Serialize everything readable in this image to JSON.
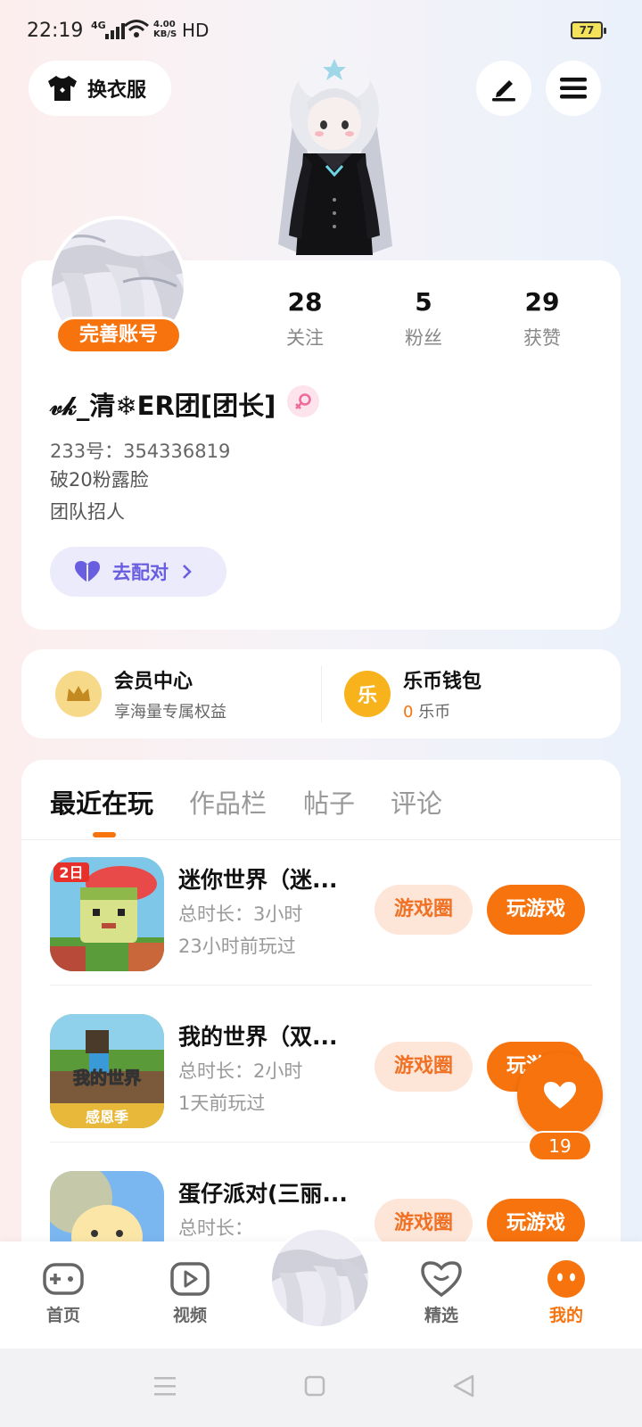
{
  "status_bar": {
    "time": "22:19",
    "network": "4G",
    "speed_top": "4.00",
    "speed_bottom": "KB/S",
    "hd": "HD",
    "battery": "77"
  },
  "top": {
    "outfit_label": "换衣服"
  },
  "profile": {
    "complete_account": "完善账号",
    "stats": [
      {
        "num": "28",
        "label": "关注"
      },
      {
        "num": "5",
        "label": "粉丝"
      },
      {
        "num": "29",
        "label": "获赞"
      }
    ],
    "username": "𝓋𝓀_清❄ER团[团长]",
    "uid": "233号：354336819",
    "bio_lines": [
      "破20粉露脸",
      "团队招人"
    ],
    "match_label": "去配对"
  },
  "member": {
    "vip_title": "会员中心",
    "vip_sub": "享海量专属权益",
    "wallet_title": "乐币钱包",
    "wallet_amount": "0",
    "wallet_unit": "乐币",
    "wallet_icon_char": "乐"
  },
  "tabs": [
    "最近在玩",
    "作品栏",
    "帖子",
    "评论"
  ],
  "games": [
    {
      "name": "迷你世界（迷...",
      "duration": "总时长：3小时",
      "last": "23小时前玩过",
      "circle": "游戏圈",
      "play": "玩游戏"
    },
    {
      "name": "我的世界（双...",
      "duration": "总时长：2小时",
      "last": "1天前玩过",
      "circle": "游戏圈",
      "play": "玩游戏",
      "icon_text_top": "我的世界",
      "icon_text_bottom": "感恩季"
    },
    {
      "name": "蛋仔派对(三丽...",
      "duration": "总时长：",
      "last": "",
      "circle": "游戏圈",
      "play": "玩游戏"
    }
  ],
  "float_like_count": "19",
  "nav": [
    {
      "label": "首页"
    },
    {
      "label": "视频"
    },
    {
      "label": "精选"
    },
    {
      "label": "我的"
    }
  ],
  "colors": {
    "accent": "#f6730e",
    "accent_light": "#fde6d8",
    "match": "#6a5ee0"
  }
}
